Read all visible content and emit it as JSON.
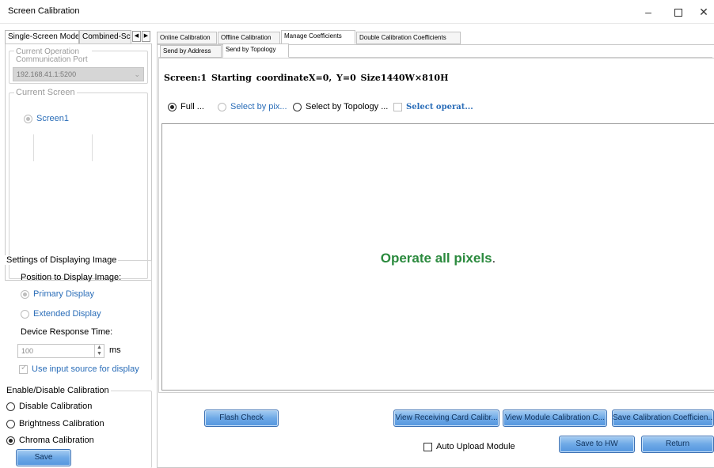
{
  "window": {
    "title": "Screen Calibration",
    "min_glyph": "–",
    "close_glyph": "✕"
  },
  "left_tabs": [
    {
      "label": "Single-Screen Mode"
    },
    {
      "label": "Combined-Sc"
    }
  ],
  "left": {
    "comm_group_label": "Current Operation Communication Port",
    "comm_port": "192.168.41.1:5200",
    "screen_group_label": "Current Screen",
    "screen_item": "Screen1",
    "display_group_label": "Settings of Displaying Image",
    "position_label": "Position to Display Image:",
    "primary_display": "Primary Display",
    "extended_display": "Extended Display",
    "response_label": "Device Response Time:",
    "response_value": "100",
    "response_unit": "ms",
    "use_input_source": "Use input source for display",
    "calib_group_label": "Enable/Disable Calibration",
    "disable_calibration": "Disable Calibration",
    "brightness_calibration": "Brightness Calibration",
    "chroma_calibration": "Chroma Calibration",
    "save_button": "Save"
  },
  "top_tabs": [
    {
      "label": "Online Calibration"
    },
    {
      "label": "Offline Calibration"
    },
    {
      "label": "Manage Coefficients"
    },
    {
      "label": "Double Calibration Coefficients"
    }
  ],
  "sub_tabs": [
    {
      "label": "Send by Address"
    },
    {
      "label": "Send by Topology"
    }
  ],
  "screen_info": "Screen:1  Starting coordinateX=0, Y=0  Size1440W×810H",
  "options": {
    "full": "Full ...",
    "select_by_pix": "Select by pix...",
    "select_by_topology": "Select by Topology ...",
    "select_operat": "Select operat..."
  },
  "operate_message": "Operate all pixels",
  "operate_message_dot": ".",
  "buttons": {
    "flash_check": "Flash Check",
    "view_receiving": "View Receiving Card Calibr...",
    "view_module": "View Module Calibration C...",
    "save_calibration": "Save Calibration Coefficien...",
    "auto_upload": "Auto Upload Module",
    "save_to_hw": "Save to HW",
    "return": "Return"
  },
  "colors": {
    "accent_button": "#6ea9e6",
    "operate_text": "#2b8a3e",
    "link_blue": "#2a6db8"
  }
}
